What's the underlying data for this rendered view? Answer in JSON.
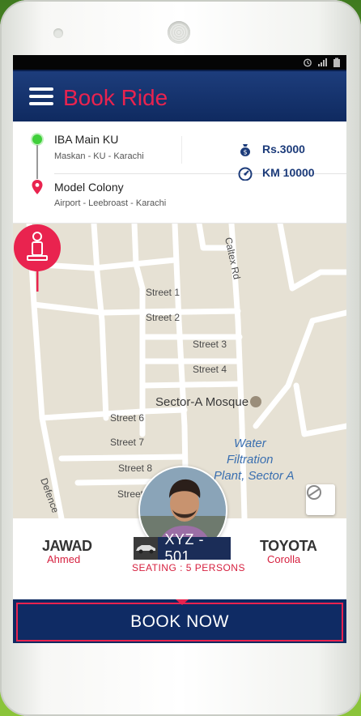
{
  "colors": {
    "accent": "#e9234f",
    "navy": "#0f2a60",
    "green_pin": "#3fcf3a"
  },
  "header": {
    "title": "Book Ride",
    "menu_icon": "hamburger-menu-icon"
  },
  "status_bar": {
    "icons": [
      "alarm-icon",
      "signal-icon",
      "battery-icon"
    ]
  },
  "route": {
    "pickup": {
      "name": "IBA Main KU",
      "address": "Maskan - KU - Karachi"
    },
    "dropoff": {
      "name": "Model Colony",
      "address": "Airport - Leebroast - Karachi"
    },
    "fare": {
      "icon": "money-bag-icon",
      "value": "Rs.3000"
    },
    "distance": {
      "icon": "speedometer-icon",
      "value": "KM 10000"
    }
  },
  "map": {
    "streets": [
      "Street 1",
      "Street 2",
      "Street 3",
      "Street 4",
      "Street 6",
      "Street 7",
      "Street 8",
      "Street",
      "Caltex Rd",
      "Defence"
    ],
    "poi": "Sector-A Mosque",
    "water_label_lines": [
      "Water",
      "Filtration",
      "Plant, Sector A"
    ],
    "marker_icon": "driver-marker-icon",
    "locate_icon": "gps-locate-icon"
  },
  "driver": {
    "first_name": "JAWAD",
    "last_name": "Ahmed",
    "plate": "XYZ - 501",
    "seating": "SEATING : 5 PERSONS",
    "car_make": "TOYOTA",
    "car_model": "Corolla"
  },
  "actions": {
    "book_now": "BOOK NOW"
  }
}
